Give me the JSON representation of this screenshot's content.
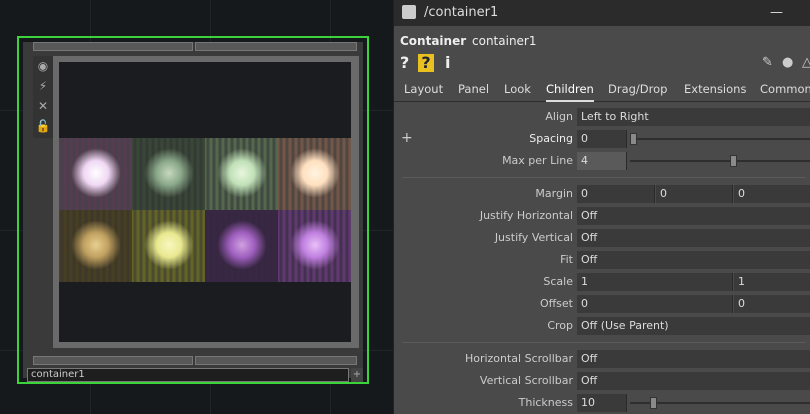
{
  "network": {
    "node_name": "container1",
    "tiles": [
      {
        "bg": "#5c3a52",
        "glow": "#f0d8f4",
        "core": "#ffffff"
      },
      {
        "bg": "#3d4a36",
        "glow": "#8aa88a",
        "core": "#c8d8c0"
      },
      {
        "bg": "#5a6e50",
        "glow": "#c0e0b8",
        "core": "#e8f6dc"
      },
      {
        "bg": "#7a5a4a",
        "glow": "#ffe0c0",
        "core": "#fff4e0"
      },
      {
        "bg": "#4a4020",
        "glow": "#c0a060",
        "core": "#e8d090"
      },
      {
        "bg": "#6a6a20",
        "glow": "#e8e890",
        "core": "#f8f8c0"
      },
      {
        "bg": "#3a2444",
        "glow": "#a060c0",
        "core": "#d0a0e0"
      },
      {
        "bg": "#6a3a7a",
        "glow": "#c080e0",
        "core": "#e8c0f8"
      }
    ]
  },
  "panel": {
    "window_title": "/container1",
    "minimize": "—",
    "op_type": "Container",
    "op_name": "container1",
    "help_icons": [
      "?",
      "?",
      "i"
    ],
    "tabs": [
      {
        "label": "Layout",
        "active": false
      },
      {
        "label": "Panel",
        "active": false
      },
      {
        "label": "Look",
        "active": false
      },
      {
        "label": "Children",
        "active": true
      },
      {
        "label": "Drag/Drop",
        "active": false
      },
      {
        "label": "Extensions",
        "active": false
      },
      {
        "label": "Common",
        "active": false
      }
    ],
    "add_symbol": "+",
    "params": {
      "align": {
        "label": "Align",
        "value": "Left to Right"
      },
      "spacing": {
        "label": "Spacing",
        "value": "0",
        "slider": 0
      },
      "max_per_line": {
        "label": "Max per Line",
        "value": "4",
        "slider": 0.5
      },
      "margin": {
        "label": "Margin",
        "values": [
          "0",
          "0",
          "0"
        ]
      },
      "justify_horizontal": {
        "label": "Justify Horizontal",
        "value": "Off"
      },
      "justify_vertical": {
        "label": "Justify Vertical",
        "value": "Off"
      },
      "fit": {
        "label": "Fit",
        "value": "Off"
      },
      "scale": {
        "label": "Scale",
        "values": [
          "1",
          "1"
        ]
      },
      "offset": {
        "label": "Offset",
        "values": [
          "0",
          "0"
        ]
      },
      "crop": {
        "label": "Crop",
        "value": "Off (Use Parent)"
      },
      "horizontal_scrollbar": {
        "label": "Horizontal Scrollbar",
        "value": "Off"
      },
      "vertical_scrollbar": {
        "label": "Vertical Scrollbar",
        "value": "Off"
      },
      "thickness": {
        "label": "Thickness",
        "value": "10",
        "slider": 0.1
      }
    }
  },
  "colors": {
    "selection_green": "#3ad43a",
    "panel_bg": "#4a4a4a"
  }
}
